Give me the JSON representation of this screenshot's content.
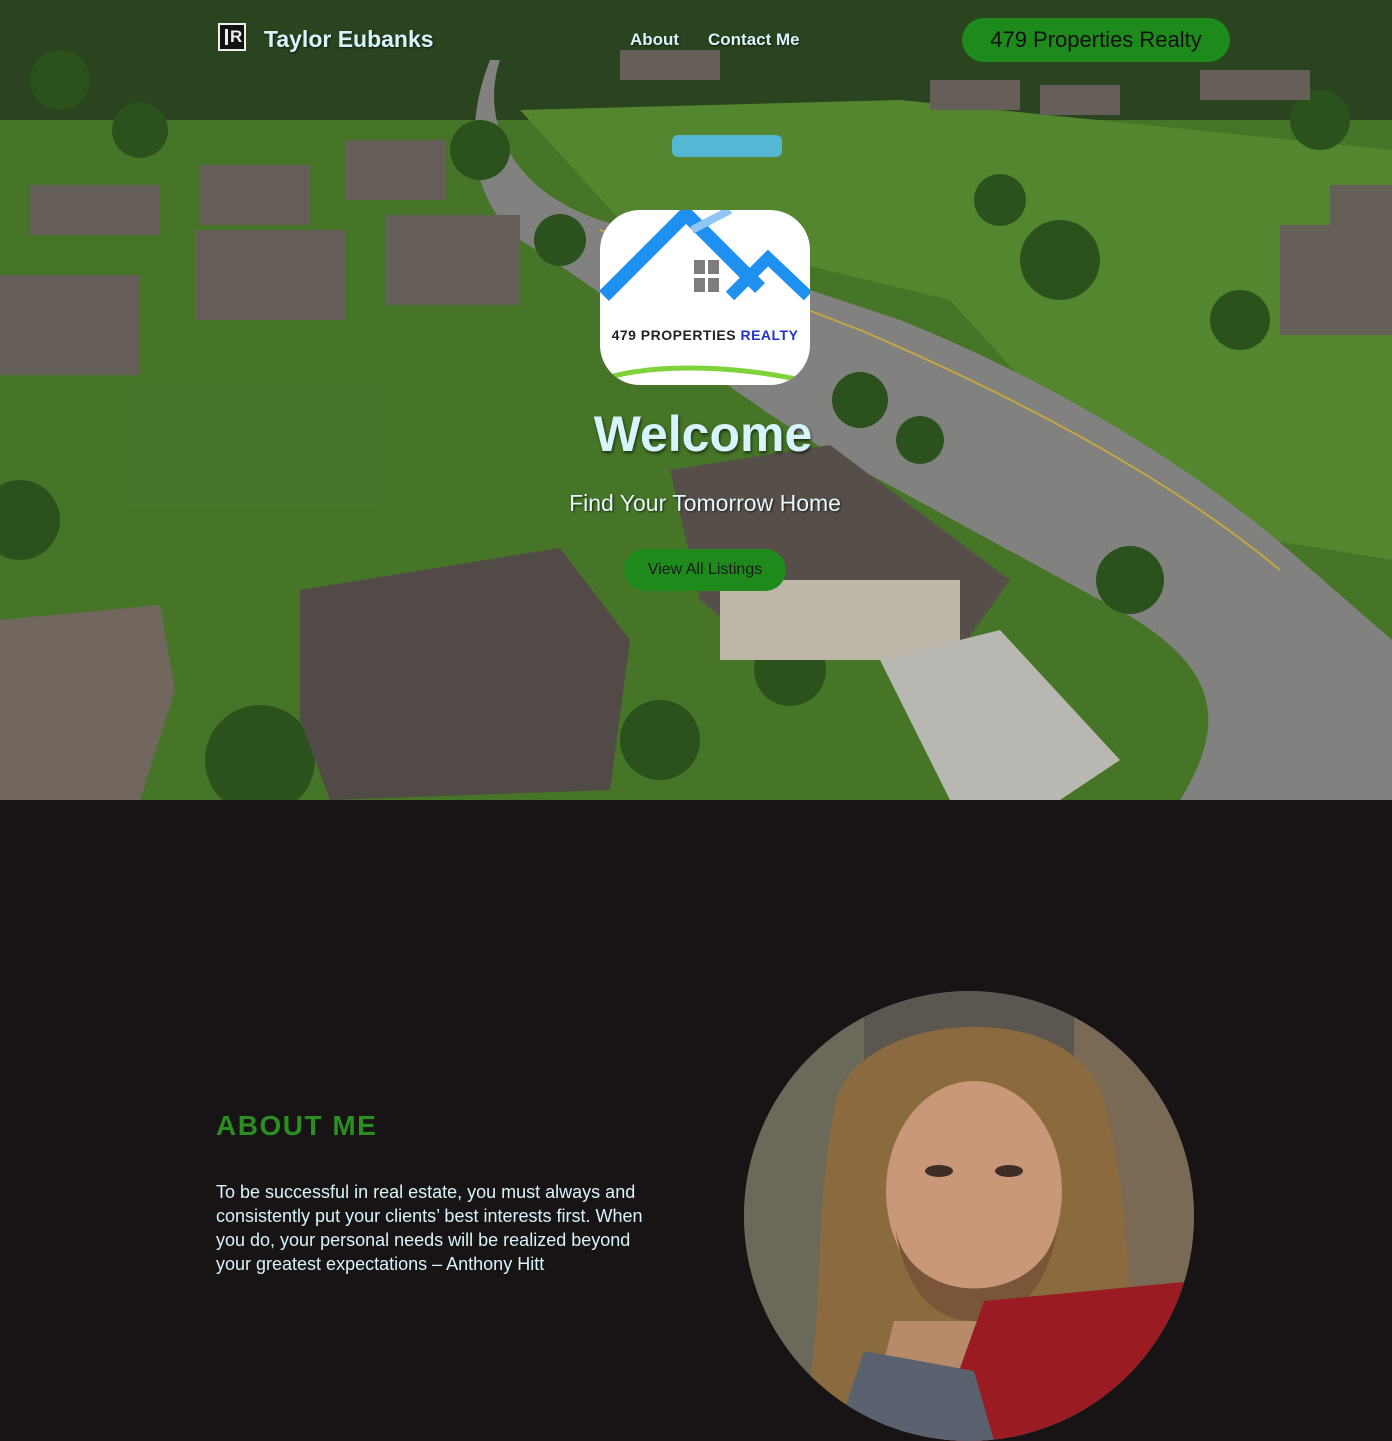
{
  "header": {
    "brand_name": "Taylor Eubanks",
    "nav": [
      {
        "label": "About"
      },
      {
        "label": "Contact Me"
      }
    ],
    "cta_label": "479 Properties Realty"
  },
  "hero": {
    "logo": {
      "word1": "479 PROPERTIES",
      "word2": "REALTY"
    },
    "title": "Welcome",
    "subtitle": "Find Your Tomorrow Home",
    "cta_label": "View All Listings"
  },
  "about": {
    "title": "ABOUT ME",
    "quote": "To be successful in real estate, you must always and consistently put your clients’ best interests first. When you do, your personal needs will be realized beyond your greatest expectations – Anthony Hitt"
  },
  "colors": {
    "accent_green": "#1f8a1c",
    "heading_green": "#2a8f20",
    "light_text": "#d8f4fb",
    "dark_bg": "#181415"
  }
}
